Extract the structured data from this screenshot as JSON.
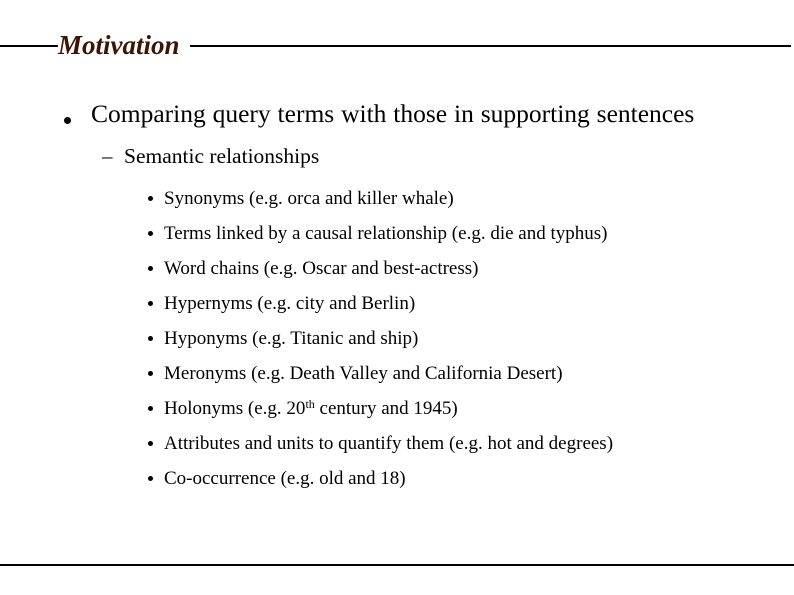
{
  "slide": {
    "title": "Motivation",
    "title_color": "#3d1506",
    "background_color": "#ffffff",
    "text_color": "#000000"
  },
  "content": {
    "level1": {
      "bullet_glyph": "round-dot",
      "text": "Comparing query terms with those in supporting sentences"
    },
    "level2": {
      "bullet_glyph": "–",
      "text": "Semantic relationships"
    },
    "level3": {
      "bullet_glyph": "round-dot",
      "items": [
        {
          "text": "Synonyms (e.g. orca and killer whale)"
        },
        {
          "text": "Terms linked by a causal relationship (e.g. die and typhus)"
        },
        {
          "text": "Word chains (e.g. Oscar and best-actress)"
        },
        {
          "text": "Hypernyms (e.g. city and Berlin)"
        },
        {
          "text": "Hyponyms (e.g. Titanic and ship)"
        },
        {
          "text": "Meronyms (e.g. Death Valley and California Desert)"
        },
        {
          "text_before": "Holonyms (e.g. 20",
          "superscript": "th",
          "text_after": " century and 1945)"
        },
        {
          "text": "Attributes and units to quantify them (e.g. hot and degrees)"
        },
        {
          "text": "Co-occurrence (e.g. old and 18)"
        }
      ]
    }
  }
}
